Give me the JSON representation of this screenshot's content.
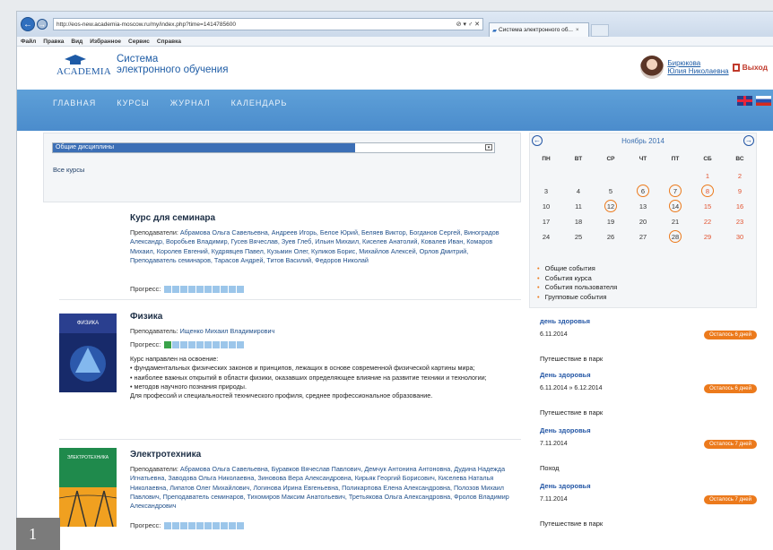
{
  "browser": {
    "url": "http://eos-new.academia-moscow.ru/my/index.php?time=1414785600",
    "url_controls": "⊘ ▾ ♂ ✕",
    "tab_label": "Система электронного об...",
    "menu": [
      "Файл",
      "Правка",
      "Вид",
      "Избранное",
      "Сервис",
      "Справка"
    ]
  },
  "site": {
    "logo_text": "ACADEMIA",
    "title_line1": "Система",
    "title_line2": "электронного обучения",
    "user_line1": "Бирюкова",
    "user_line2": "Юлия Николаевна",
    "logout": "Выход",
    "nav": [
      "ГЛАВНАЯ",
      "КУРСЫ",
      "ЖУРНАЛ",
      "КАЛЕНДАРЬ"
    ]
  },
  "filter": {
    "selected": "Общие дисциплины",
    "all_courses": "Все курсы"
  },
  "courses": [
    {
      "title": "Курс для семинара",
      "teachers_label": "Преподаватели:",
      "teachers": " Абрамова Ольга Савельевна, Андреев Игорь, Белое Юрий, Беляев Виктор, Богданов Сергей, Виноградов Александр, Воробьев Владимир, Гусев Вячеслав, Зуев Глеб, Ильин Михаил, Киселев Анатолий, Ковалев Иван, Комаров Михаил, Королев Евгений, Кудрявцев Павел, Кузьмин Олег, Куликов Борис, Михайлов Алексей, Орлов Дмитрий, Преподаватель семинаров, Тарасов Андрей, Титов Василий, Федоров Николай",
      "progress_label": "Прогресс:",
      "progress_done": 0
    },
    {
      "title": "Физика",
      "teachers_label": "Преподаватель:",
      "teachers": " Ищенко Михаил Владимирович",
      "progress_label": "Прогресс:",
      "progress_done": 1,
      "cover_title": "ФИЗИКА",
      "description": [
        "Курс направлен на освоение:",
        "•   фундаментальных физических законов и принципов, лежащих в основе современной физической картины мира;",
        "•   наиболее важных открытий в области физики, оказавших определяющее влияние на развитие техники и технологии;",
        "•   методов научного познания природы.",
        "Для профессий и специальностей технического профиля, среднее профессиональное образование."
      ]
    },
    {
      "title": "Электротехника",
      "teachers_label": "Преподаватели:",
      "teachers": " Абрамова Ольга Савельевна, Буравков Вячеслав Павлович, Демчук Антонина Антоновна, Дудина Надежда Игнатьевна, Заводова Ольга Николаевна, Зиновова Вера Александровна, Кирьяк Георгий Борисович, Киселева Наталья Николаевна, Липатов Олег Михайлович, Логинова Ирина Евгеньевна, Поликарпова Елена Александровна, Полозов Михаил Павлович, Преподаватель семинаров, Тихомиров Максим Анатольевич, Третьякова Ольга Александровна, Фролов Владимир Александрович",
      "progress_label": "Прогресс:",
      "progress_done": 0,
      "cover_title": "ЭЛЕКТРОТЕХНИКА"
    }
  ],
  "progress_segments": 10,
  "calendar": {
    "month": "Ноябрь 2014",
    "dows": [
      "ПН",
      "ВТ",
      "СР",
      "ЧТ",
      "ПТ",
      "СБ",
      "ВС"
    ],
    "weeks": [
      [
        "",
        "",
        "",
        "",
        "",
        "1",
        "2"
      ],
      [
        "3",
        "4",
        "5",
        "6",
        "7",
        "8",
        "9"
      ],
      [
        "10",
        "11",
        "12",
        "13",
        "14",
        "15",
        "16"
      ],
      [
        "17",
        "18",
        "19",
        "20",
        "21",
        "22",
        "23"
      ],
      [
        "24",
        "25",
        "26",
        "27",
        "28",
        "29",
        "30"
      ]
    ],
    "ringed": [
      "6",
      "7",
      "8",
      "12",
      "14",
      "28"
    ],
    "legend": [
      "Общие события",
      "События курса",
      "События пользователя",
      "Групповые события"
    ]
  },
  "events": [
    {
      "name": "день здоровья",
      "date": "6.11.2014",
      "badge": "Осталось 6 дней"
    },
    {
      "plain": "Путешествие в парк"
    },
    {
      "name": "День здоровья",
      "date": "6.11.2014 » 6.12.2014",
      "badge": "Осталось 6 дней"
    },
    {
      "plain": "Путешествие в парк"
    },
    {
      "name": "День здоровья",
      "date": "7.11.2014",
      "badge": "Осталось 7 дней"
    },
    {
      "plain": "Поход"
    },
    {
      "name": "День здоровья",
      "date": "7.11.2014",
      "badge": "Осталось 7 дней"
    },
    {
      "plain": "Путешествие в парк"
    }
  ],
  "figure_number": "1",
  "colors": {
    "nav": "#4b8ccc",
    "accent": "#ec7a1c",
    "link": "#1f5da6"
  }
}
